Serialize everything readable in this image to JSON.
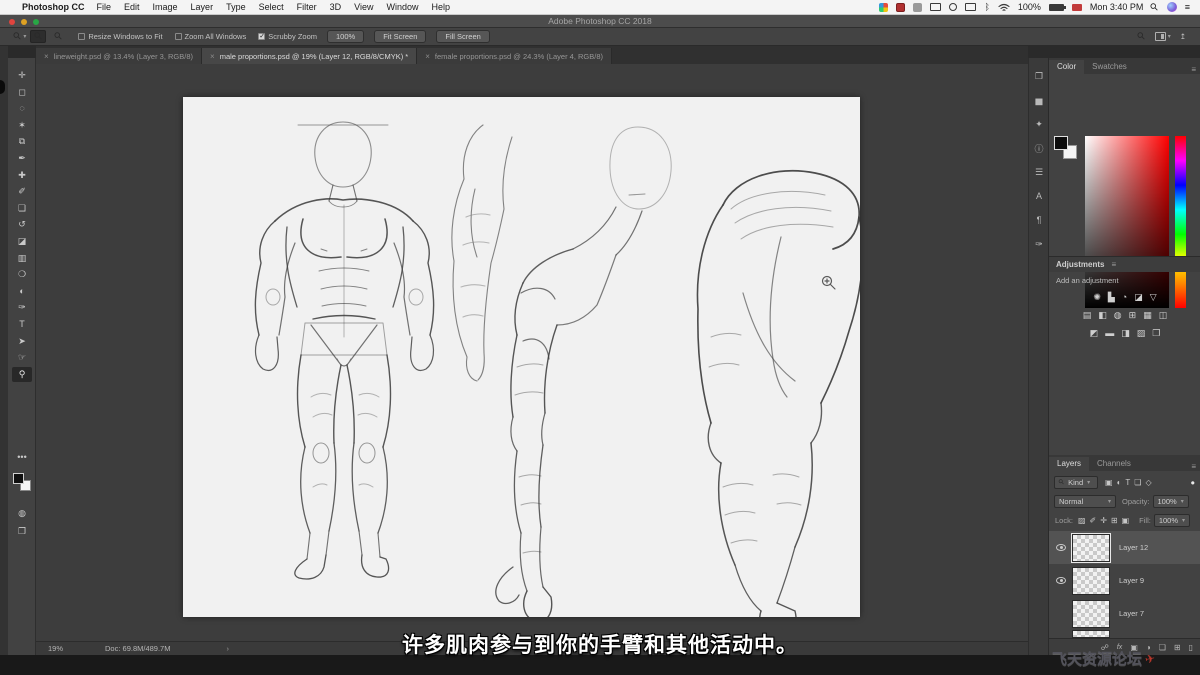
{
  "menubar": {
    "apple": "",
    "app_name": "Photoshop CC",
    "items": [
      "File",
      "Edit",
      "Image",
      "Layer",
      "Type",
      "Select",
      "Filter",
      "3D",
      "View",
      "Window",
      "Help"
    ],
    "battery": "100%",
    "clock": "Mon 3:40 PM"
  },
  "titlebar": {
    "title": "Adobe Photoshop CC 2018"
  },
  "options_bar": {
    "checkboxes": [
      {
        "label": "Resize Windows to Fit",
        "checked": false
      },
      {
        "label": "Zoom All Windows",
        "checked": false
      },
      {
        "label": "Scrubby Zoom",
        "checked": true
      }
    ],
    "buttons": {
      "zoom_100": "100%",
      "fit_screen": "Fit Screen",
      "fill_screen": "Fill Screen"
    }
  },
  "document_tabs": [
    {
      "close": "×",
      "label": "lineweight.psd @ 13.4% (Layer 3, RGB/8)",
      "active": false
    },
    {
      "close": "×",
      "label": "male proportions.psd @ 19% (Layer 12, RGB/8/CMYK) *",
      "active": true
    },
    {
      "close": "×",
      "label": "female proportions.psd @ 24.3% (Layer 4, RGB/8)",
      "active": false
    }
  ],
  "toolbar": {
    "tools": [
      "move",
      "rectangular-marquee",
      "lasso",
      "quick-selection",
      "crop",
      "eyedropper",
      "spot-healing",
      "brush",
      "clone-stamp",
      "history-brush",
      "eraser",
      "gradient",
      "blur",
      "dodge",
      "pen",
      "type",
      "path-selection",
      "hand",
      "zoom"
    ],
    "active_tool": "zoom",
    "more_label": "•••"
  },
  "dock_icons": [
    "libraries",
    "histogram",
    "navigator",
    "info",
    "properties",
    "character",
    "paragraph",
    "brush-settings"
  ],
  "panels": {
    "color": {
      "tab_color": "Color",
      "tab_swatches": "Swatches"
    },
    "adjustments": {
      "title": "Adjustments",
      "hint": "Add an adjustment",
      "icons": [
        "brightness-contrast",
        "levels",
        "curves",
        "exposure",
        "vibrance",
        "hue-saturation",
        "color-balance",
        "black-white",
        "photo-filter",
        "channel-mixer",
        "color-lookup",
        "invert",
        "posterize",
        "threshold",
        "gradient-map",
        "selective-color"
      ]
    },
    "layers": {
      "tab_layers": "Layers",
      "tab_channels": "Channels",
      "filter_label": "Kind",
      "blend_mode": "Normal",
      "opacity_label": "Opacity:",
      "opacity_value": "100%",
      "lock_label": "Lock:",
      "fill_label": "Fill:",
      "fill_value": "100%",
      "items": [
        {
          "name": "Layer 12",
          "selected": true,
          "visible": true
        },
        {
          "name": "Layer 9",
          "selected": false,
          "visible": true
        },
        {
          "name": "Layer 7",
          "selected": false,
          "visible": false
        }
      ]
    }
  },
  "statusbar": {
    "zoom_level": "19%",
    "doc_info": "Doc: 69.8M/489.7M",
    "chevron": "›"
  },
  "subtitle": "许多肌肉参与到你的手臂和其他活动中。",
  "watermark": {
    "text": "飞天资源论坛"
  },
  "colors": {
    "accent_red": "#b8372b",
    "ui_dark": "#424242",
    "artboard": "#f1f1f1"
  }
}
